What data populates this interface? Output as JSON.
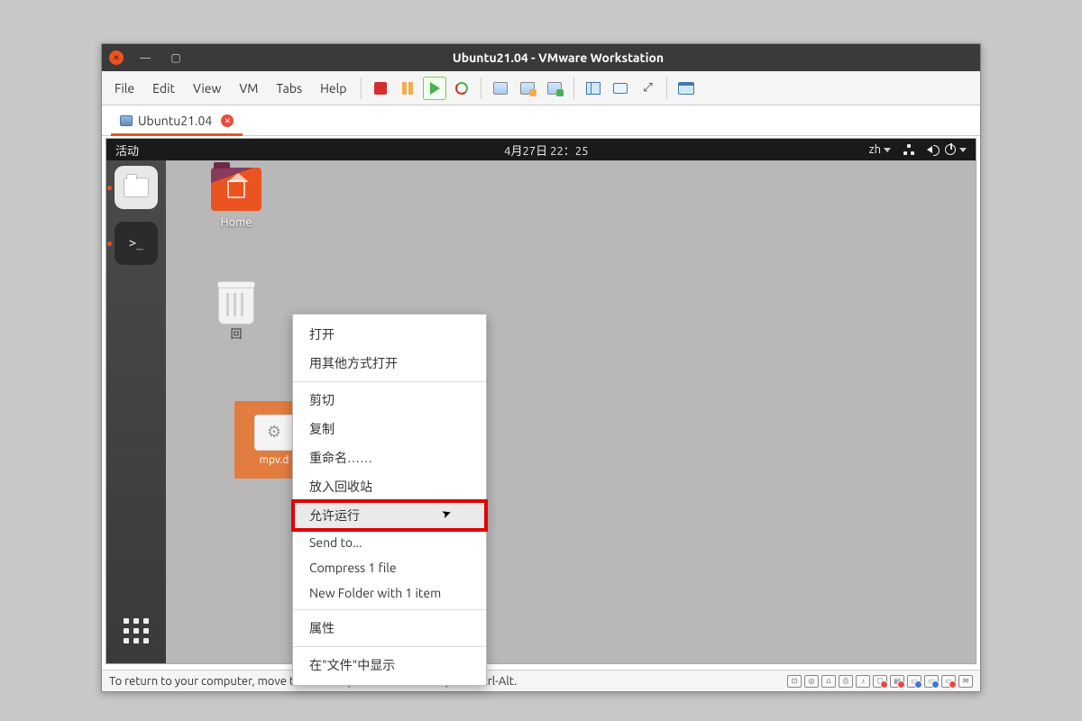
{
  "titlebar": {
    "title": "Ubuntu21.04 - VMware Workstation"
  },
  "menubar": {
    "items": [
      "File",
      "Edit",
      "View",
      "VM",
      "Tabs",
      "Help"
    ]
  },
  "tab": {
    "label": "Ubuntu21.04"
  },
  "ubuntu_topbar": {
    "activities": "活动",
    "datetime": "4月27日  22：25",
    "lang": "zh"
  },
  "desktop": {
    "home_label": "Home",
    "trash_label": "回",
    "selected_label": "mpv.d"
  },
  "context_menu": {
    "open": "打开",
    "open_with": "用其他方式打开",
    "cut": "剪切",
    "copy": "复制",
    "rename": "重命名……",
    "trash": "放入回收站",
    "allow_run": "允许运行",
    "send_to": "Send to...",
    "compress": "Compress 1 file",
    "new_folder": "New Folder with 1 item",
    "properties": "属性",
    "show_in_files": "在\"文件\"中显示"
  },
  "statusbar": {
    "text": "To return to your computer, move the mouse pointer outside or press Ctrl-Alt."
  }
}
